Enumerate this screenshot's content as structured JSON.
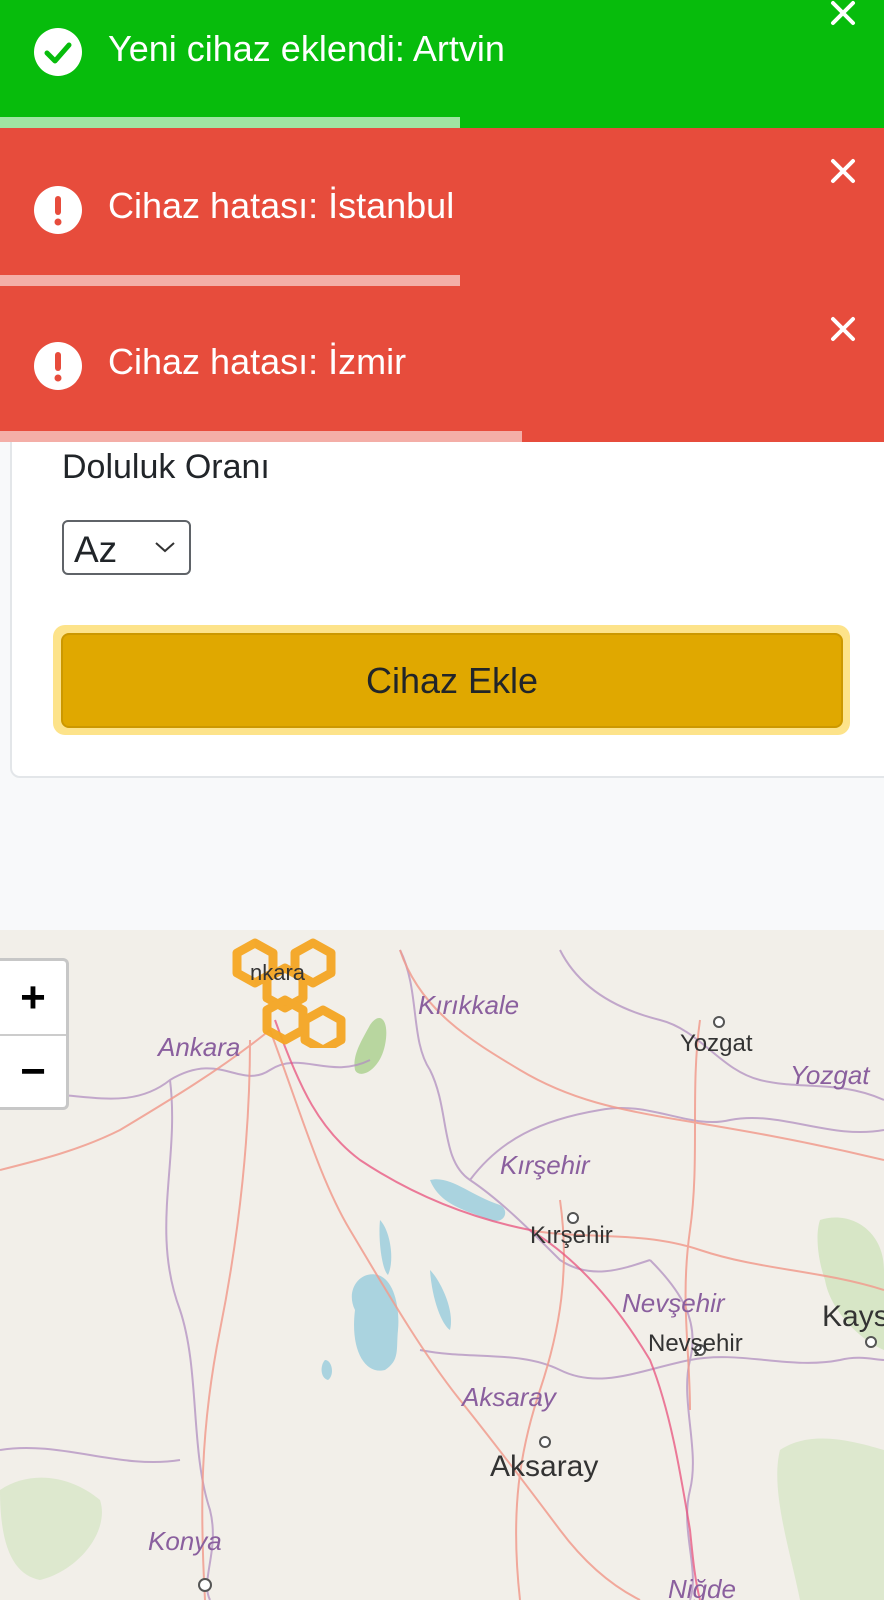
{
  "toasts": [
    {
      "type": "success",
      "icon": "check-circle-icon",
      "message": "Yeni cihaz eklendi: Artvin",
      "progress": 0.52,
      "color": "#07bc0c"
    },
    {
      "type": "error",
      "icon": "exclamation-circle-icon",
      "message": "Cihaz hatası: İstanbul",
      "progress": 0.52,
      "color": "#e74c3c"
    },
    {
      "type": "error",
      "icon": "exclamation-circle-icon",
      "message": "Cihaz hatası: İzmir",
      "progress": 0.59,
      "color": "#e74c3c"
    }
  ],
  "form": {
    "fill_label": "Doluluk Oranı",
    "fill_select": {
      "selected": "Az"
    },
    "add_button": "Cihaz Ekle",
    "button_color": "#e0a800"
  },
  "map": {
    "zoom_in": "+",
    "zoom_out": "−",
    "labels": {
      "ankara_prov": "Ankara",
      "ankara_city": "nkara",
      "kirikkale_prov": "Kırıkkale",
      "yozgat_city": "Yozgat",
      "yozgat_prov": "Yozgat",
      "kirsehir_prov": "Kırşehir",
      "kirsehir_city": "Kırşehir",
      "nevsehir_prov": "Nevşehir",
      "nevsehir_city": "Nevşehir",
      "kays_city": "Kays",
      "aksaray_prov": "Aksaray",
      "aksaray_city": "Aksaray",
      "konya_prov": "Konya",
      "nigde_prov": "Niğde"
    },
    "hex_color": "#f5a623"
  }
}
